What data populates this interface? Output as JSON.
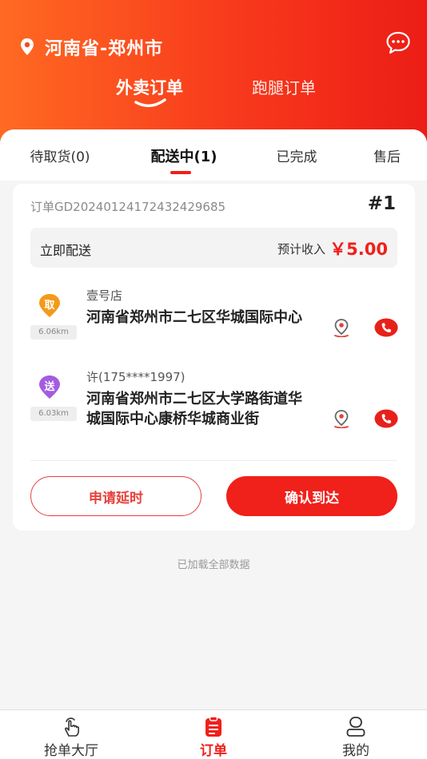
{
  "header": {
    "location": "河南省-郑州市",
    "tabs": [
      "外卖订单",
      "跑腿订单"
    ],
    "active_tab": 0
  },
  "sub_tabs": [
    "待取货(0)",
    "配送中(1)",
    "已完成",
    "售后"
  ],
  "active_sub_tab": 1,
  "order": {
    "order_no": "订单GD20240124172432429685",
    "index": "#1",
    "delivery_type": "立即配送",
    "income_label": "预计收入",
    "income_value": "￥5.00",
    "pickup": {
      "badge": "取",
      "badge_color": "#f39a19",
      "distance": "6.06km",
      "name": "壹号店",
      "address": "河南省郑州市二七区华城国际中心"
    },
    "dropoff": {
      "badge": "送",
      "badge_color": "#a45ce0",
      "distance": "6.03km",
      "name": "许(175****1997)",
      "address": "河南省郑州市二七区大学路街道华城国际中心康桥华城商业街"
    },
    "delay_button": "申请延时",
    "confirm_button": "确认到达"
  },
  "footer_text": "已加载全部数据",
  "bottom_nav": [
    {
      "label": "抢单大厅",
      "icon": "hand-tap-icon"
    },
    {
      "label": "订单",
      "icon": "clipboard-icon"
    },
    {
      "label": "我的",
      "icon": "user-icon"
    }
  ],
  "colors": {
    "brand": "#f0201a",
    "header_start": "#ff6a22",
    "header_end": "#ec1d16"
  }
}
